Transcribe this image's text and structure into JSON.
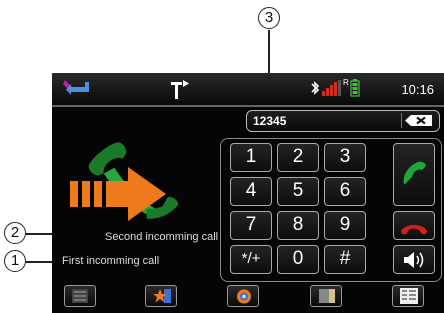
{
  "callouts": {
    "one": "1",
    "two": "2",
    "three": "3"
  },
  "status_bar": {
    "time": "10:16",
    "icons": [
      "back-arrow-icon",
      "navigation-turn-icon",
      "bluetooth-icon",
      "signal-strength-icon",
      "roaming-icon",
      "battery-icon"
    ],
    "roaming_label": "R"
  },
  "display": {
    "number": "12345"
  },
  "keypad": {
    "keys": [
      "1",
      "2",
      "3",
      "4",
      "5",
      "6",
      "7",
      "8",
      "9",
      "*/+",
      "0",
      "#"
    ]
  },
  "labels": {
    "second_call": "Second incomming call",
    "first_call": "First incomming call"
  },
  "bottom_bar": {
    "icons": [
      "call-list-icon",
      "favorites-icon",
      "settings-icon",
      "phonebook-icon",
      "call-log-icon"
    ]
  },
  "colors": {
    "accept": "#1fa83a",
    "reject": "#d4201a",
    "arrow": "#ee7a1c",
    "battery": "#3cc33c",
    "signal_red": "#d62a1a"
  }
}
